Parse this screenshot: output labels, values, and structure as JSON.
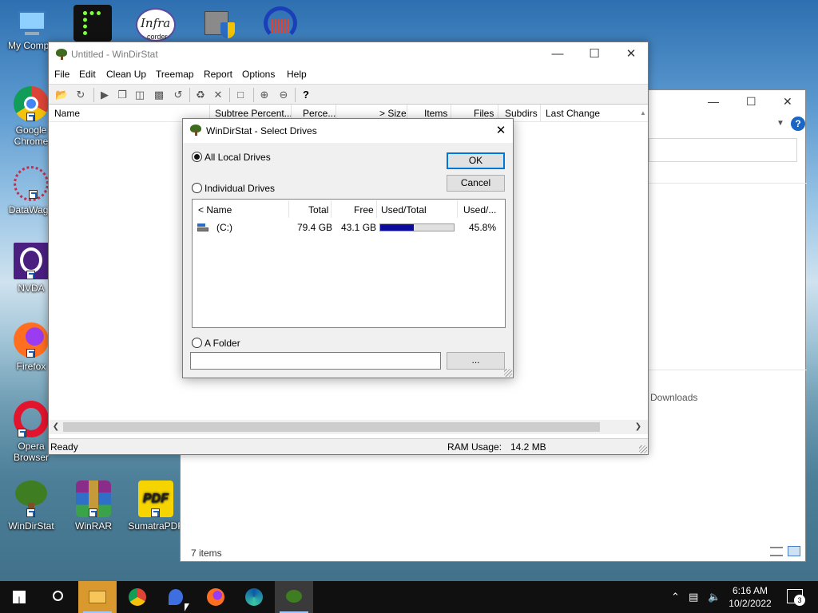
{
  "desktop": {
    "icons": [
      {
        "label": "My Compu",
        "icon": "computer-icon"
      },
      {
        "label": "Google Chrome",
        "icon": "chrome-icon"
      },
      {
        "label": "DataWago",
        "icon": "datawago-icon"
      },
      {
        "label": "NVDA",
        "icon": "nvda-icon"
      },
      {
        "label": "Firefox",
        "icon": "firefox-icon"
      },
      {
        "label": "Opera Browser",
        "icon": "opera-icon"
      },
      {
        "label": "WinDirStat",
        "icon": "windirstat-icon"
      },
      {
        "label": "WinRAR",
        "icon": "winrar-icon"
      },
      {
        "label": "SumatraPDF",
        "icon": "sumatrapdf-icon"
      }
    ],
    "top_icons_text": {
      "infra": "Infra",
      "recorder": "corder"
    }
  },
  "explorer": {
    "downloads_label": "Downloads",
    "items_count": "7 items"
  },
  "wds": {
    "title": "Untitled - WinDirStat",
    "menu": [
      "File",
      "Edit",
      "Clean Up",
      "Treemap",
      "Report",
      "Options",
      "Help"
    ],
    "columns": [
      "Name",
      "Subtree Percent...",
      "Perce...",
      "> Size",
      "Items",
      "Files",
      "Subdirs",
      "Last Change"
    ],
    "status": {
      "text": "Ready",
      "ram_label": "RAM Usage:",
      "ram_value": "14.2 MB"
    }
  },
  "dialog": {
    "title": "WinDirStat - Select Drives",
    "all_local": "All Local Drives",
    "individual": "Individual Drives",
    "a_folder": "A Folder",
    "ok": "OK",
    "cancel": "Cancel",
    "browse": "...",
    "selected_option": "all_local",
    "list_columns": [
      "< Name",
      "Total",
      "Free",
      "Used/Total",
      "Used/..."
    ],
    "drives": [
      {
        "name": "(C:)",
        "total": "79.4 GB",
        "free": "43.1 GB",
        "used_fraction": 0.458,
        "used_pct": "45.8%"
      }
    ],
    "folder_value": ""
  },
  "taskbar": {
    "time": "6:16 AM",
    "date": "10/2/2022",
    "notifications": "3",
    "colors": {
      "accent": "#0078d7",
      "bar_fill": "#0c0c9c"
    }
  }
}
